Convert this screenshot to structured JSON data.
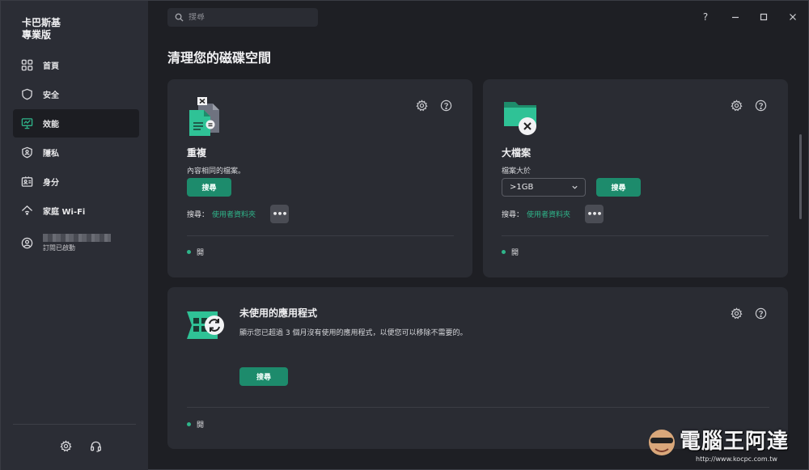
{
  "brand": {
    "line1": "卡巴斯基",
    "line2": "專業版"
  },
  "search": {
    "placeholder": "搜尋"
  },
  "window_controls": {
    "help": "?"
  },
  "sidebar": {
    "items": [
      {
        "label": "首頁",
        "icon": "grid-icon"
      },
      {
        "label": "安全",
        "icon": "shield-icon"
      },
      {
        "label": "效能",
        "icon": "monitor-icon"
      },
      {
        "label": "隱私",
        "icon": "privacy-shield-icon"
      },
      {
        "label": "身分",
        "icon": "id-card-icon"
      },
      {
        "label": "家庭 Wi-Fi",
        "icon": "home-wifi-icon"
      }
    ],
    "account_status": "訂閱已啟動",
    "active_index": 2
  },
  "main": {
    "title": "清理您的磁碟空間",
    "cards": {
      "duplicates": {
        "title": "重複",
        "description": "內容相同的檔案。",
        "button": "搜尋",
        "scan_label": "搜尋：",
        "scan_link": "使用者資料夾",
        "more": "•••",
        "status": "開"
      },
      "large_files": {
        "title": "大檔案",
        "size_label": "檔案大於",
        "size_value": ">1GB",
        "button": "搜尋",
        "scan_label": "搜尋：",
        "scan_link": "使用者資料夾",
        "more": "•••",
        "status": "開"
      },
      "unused_apps": {
        "title": "未使用的應用程式",
        "description": "顯示您已超過 3 個月沒有使用的應用程式，以便您可以移除不需要的。",
        "button": "搜尋",
        "status": "開"
      }
    }
  },
  "watermark": {
    "text": "電腦王阿達",
    "url": "http://www.kocpc.com.tw"
  },
  "colors": {
    "accent": "#1d8b6c",
    "link": "#2fb58a",
    "sidebar": "#2b2d35",
    "card": "#2a2c33"
  }
}
